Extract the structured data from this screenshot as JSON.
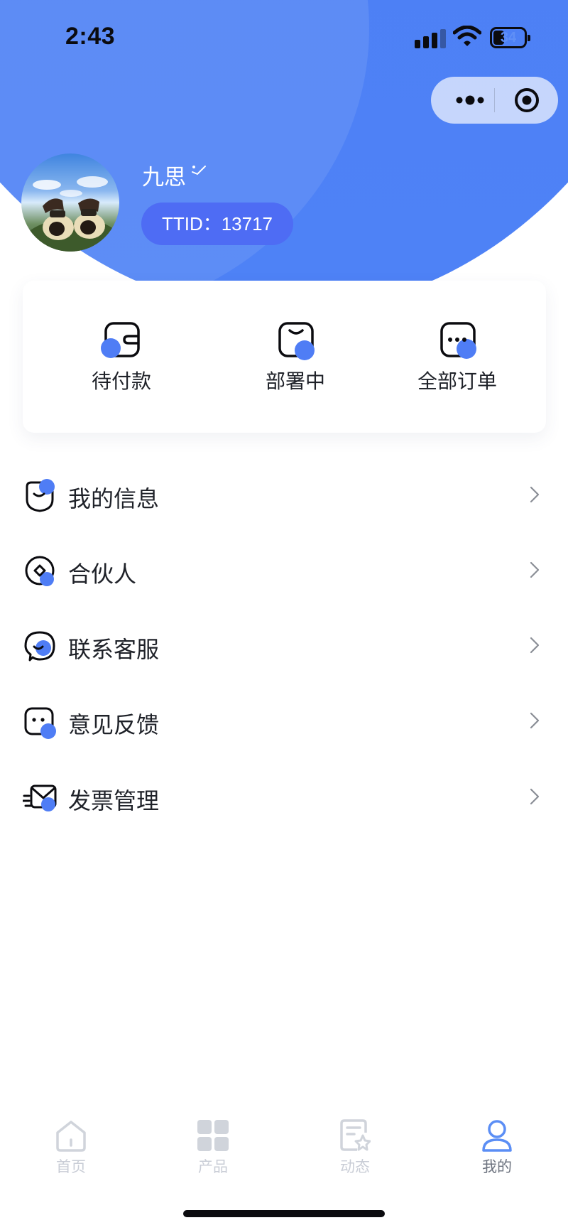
{
  "status_bar": {
    "time": "2:43",
    "battery_level": "34",
    "icons": [
      "cellular-signal-icon",
      "wifi-icon",
      "battery-icon"
    ]
  },
  "capsule": {
    "icons": [
      "more-dots-icon",
      "close-target-icon"
    ]
  },
  "profile": {
    "username": "九思",
    "ttid": "TTID：13717",
    "avatar_icon": "avatar-photo"
  },
  "orders": {
    "items": [
      {
        "label": "待付款",
        "icon": "wallet-icon"
      },
      {
        "label": "部署中",
        "icon": "box-smile-icon"
      },
      {
        "label": "全部订单",
        "icon": "dots-box-icon"
      }
    ]
  },
  "menu": {
    "items": [
      {
        "label": "我的信息",
        "icon": "shield-smile-icon"
      },
      {
        "label": "合伙人",
        "icon": "diamond-circle-icon"
      },
      {
        "label": "联系客服",
        "icon": "chat-bubble-icon"
      },
      {
        "label": "意见反馈",
        "icon": "feedback-face-icon"
      },
      {
        "label": "发票管理",
        "icon": "envelope-send-icon"
      }
    ],
    "chevron_icon": "chevron-right-icon"
  },
  "tabbar": {
    "items": [
      {
        "label": "首页",
        "icon": "home-icon",
        "active": false
      },
      {
        "label": "产品",
        "icon": "grid-icon",
        "active": false
      },
      {
        "label": "动态",
        "icon": "doc-star-icon",
        "active": false
      },
      {
        "label": "我的",
        "icon": "person-icon",
        "active": true
      }
    ]
  },
  "colors": {
    "header_blue": "#4e82f6",
    "accent_blue": "#4f7df5",
    "ttid_pill": "#4e6cf4",
    "tab_inactive": "#c9cdd6",
    "tab_active_icon": "#5b8ef5",
    "text_primary": "#1f2229"
  }
}
